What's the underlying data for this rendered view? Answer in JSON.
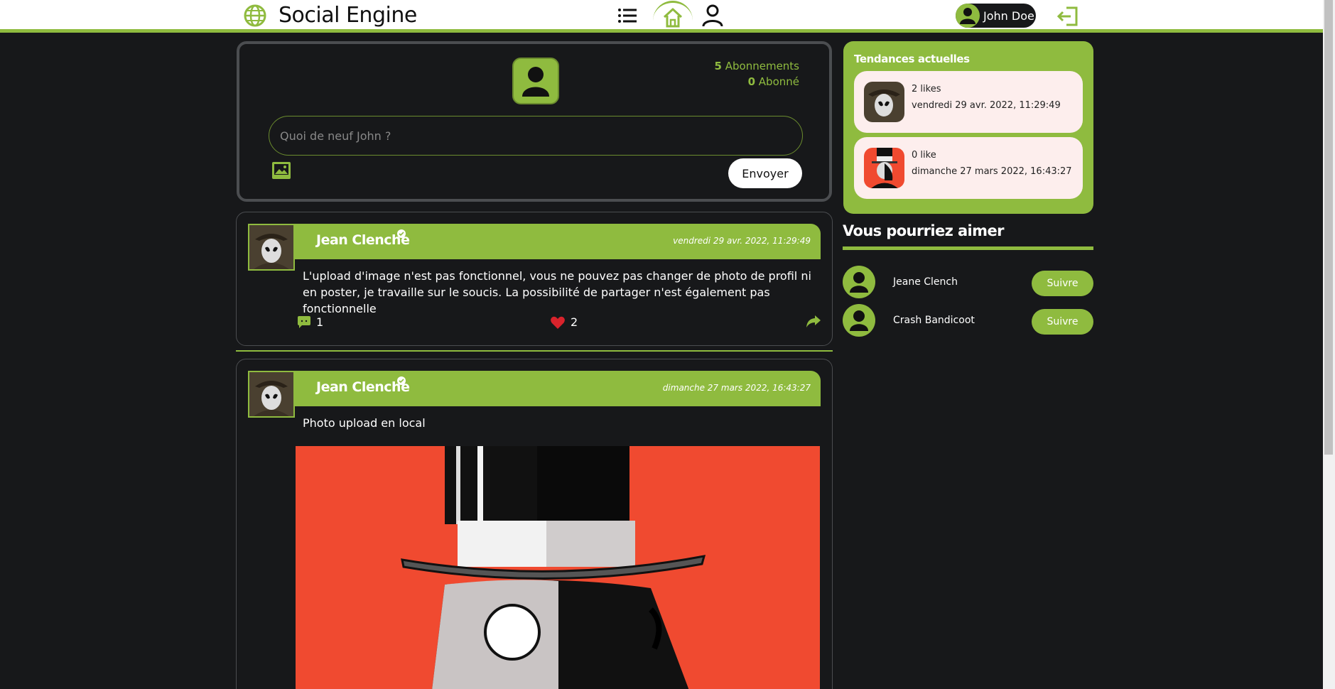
{
  "app": {
    "title": "Social Engine"
  },
  "header": {
    "user_name": "John Doe"
  },
  "composer": {
    "following_count": "5",
    "following_label": "Abonnements",
    "followers_count": "0",
    "followers_label": "Abonné",
    "placeholder": "Quoi de neuf John ?",
    "send_label": "Envoyer"
  },
  "posts": [
    {
      "author": "Jean Clenche",
      "date": "vendredi 29 avr. 2022, 11:29:49",
      "text": "L'upload d'image n'est pas fonctionnel, vous ne pouvez pas changer de photo de profil ni en poster, je travaille sur le soucis. La possibilité de partager n'est également pas fonctionnelle",
      "comments": "1",
      "likes": "2"
    },
    {
      "author": "Jean Clenche",
      "date": "dimanche 27 mars 2022, 16:43:27",
      "text": "Photo upload en local"
    }
  ],
  "trends": {
    "title": "Tendances actuelles",
    "items": [
      {
        "likes": "2 likes",
        "date": "vendredi 29 avr. 2022, 11:29:49"
      },
      {
        "likes": "0 like",
        "date": "dimanche 27 mars 2022, 16:43:27"
      }
    ]
  },
  "suggestions": {
    "title": "Vous pourriez aimer",
    "items": [
      {
        "name": "Jeane Clench",
        "button": "Suivre"
      },
      {
        "name": "Crash Bandicoot",
        "button": "Suivre"
      }
    ]
  },
  "colors": {
    "accent": "#8fbb3f",
    "background": "#17181a",
    "trend_card": "#fdeeed",
    "image_bg": "#f04a30"
  }
}
